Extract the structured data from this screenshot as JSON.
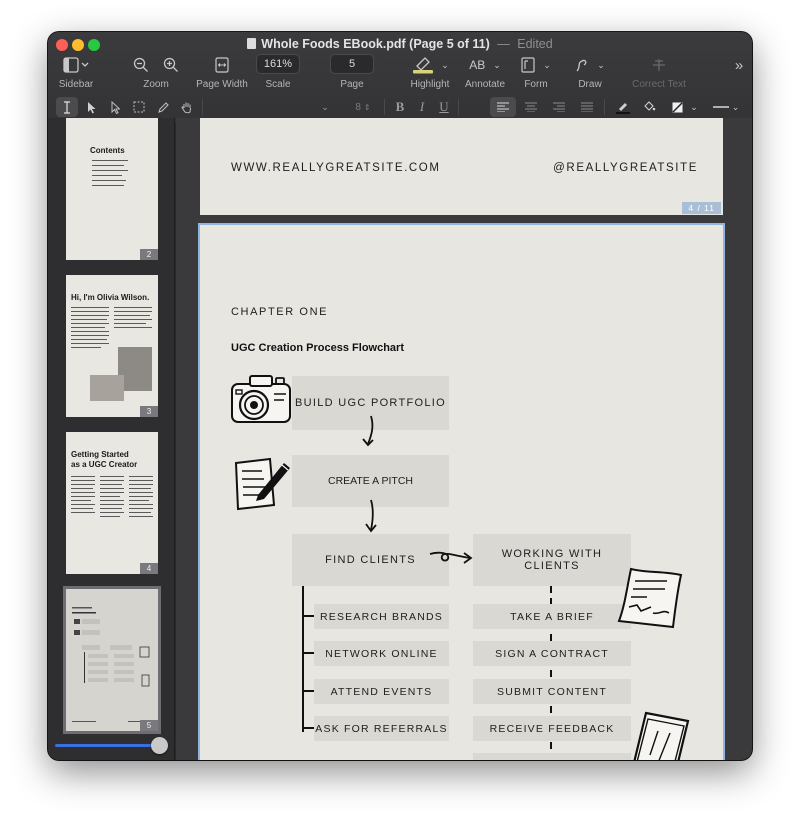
{
  "window": {
    "title": "Whole Foods EBook.pdf (Page 5 of 11)",
    "separator": "—",
    "status": "Edited"
  },
  "toolbar": {
    "sidebar": {
      "label": "Sidebar",
      "icon": "sidebar-icon"
    },
    "zoom": {
      "label": "Zoom",
      "icons": [
        "zoom-out-icon",
        "zoom-in-icon"
      ]
    },
    "page_width": {
      "label": "Page Width",
      "icon": "page-width-icon"
    },
    "scale": {
      "label": "Scale",
      "value": "161%"
    },
    "page": {
      "label": "Page",
      "value": "5"
    },
    "highlight": {
      "label": "Highlight",
      "icon": "highlighter-icon"
    },
    "annotate": {
      "label": "Annotate",
      "icon_text": "AB"
    },
    "form": {
      "label": "Form",
      "icon": "form-icon"
    },
    "draw": {
      "label": "Draw",
      "icon": "draw-icon"
    },
    "correct_text": {
      "label": "Correct Text",
      "icon": "correct-text-icon"
    },
    "more": {
      "icon": "more-chevrons-icon"
    }
  },
  "format_bar": {
    "font_size": "8",
    "bold": "B",
    "italic": "I",
    "underline": "U",
    "accent_color": "#3a6fe0"
  },
  "thumbnails": [
    {
      "page": "2",
      "heading": "Contents"
    },
    {
      "page": "3",
      "heading": "Hi, I'm Olivia Wilson."
    },
    {
      "page": "4",
      "heading_line1": "Getting Started",
      "heading_line2": "as a UGC Creator"
    },
    {
      "page": "5",
      "selected": true
    }
  ],
  "page4": {
    "website": "WWW.REALLYGREATSITE.COM",
    "handle": "@REALLYGREATSITE",
    "badge": "4 / 11"
  },
  "page5": {
    "chapter": "CHAPTER ONE",
    "title": "UGC Creation Process Flowchart",
    "steps": [
      {
        "label": "BUILD UGC PORTFOLIO",
        "icon": "camera-icon"
      },
      {
        "label": "CREATE A PITCH",
        "icon": "notepad-pen-icon"
      },
      {
        "label": "FIND CLIENTS"
      }
    ],
    "working": {
      "label": "WORKING WITH CLIENTS",
      "icons": [
        "document-icon",
        "phone-icon"
      ]
    },
    "find_clients_tasks": [
      "RESEARCH BRANDS",
      "NETWORK ONLINE",
      "ATTEND EVENTS",
      "ASK FOR REFERRALS"
    ],
    "working_tasks": [
      "TAKE A BRIEF",
      "SIGN A CONTRACT",
      "SUBMIT CONTENT",
      "RECEIVE FEEDBACK"
    ]
  }
}
